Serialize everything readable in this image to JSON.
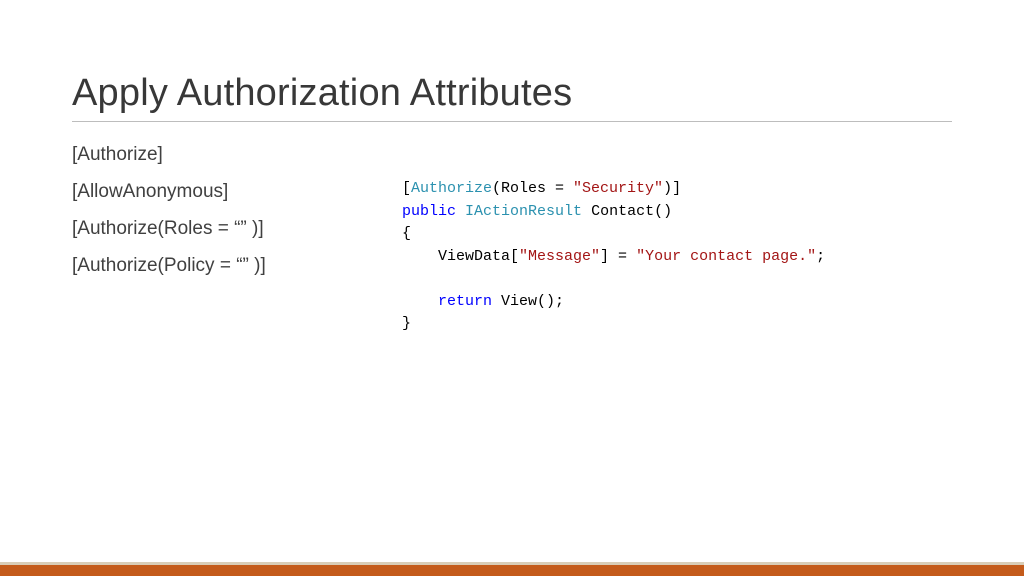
{
  "title": "Apply Authorization Attributes",
  "bullets": [
    "[Authorize]",
    "[AllowAnonymous]",
    "[Authorize(Roles = “” )]",
    "[Authorize(Policy = “” )]"
  ],
  "code": {
    "l1": {
      "open": "[",
      "attr": "Authorize",
      "paren_open": "(Roles = ",
      "str": "\"Security\"",
      "paren_close": ")",
      "close": "]"
    },
    "l2": {
      "kw1": "public",
      "sp1": " ",
      "type": "IActionResult",
      "sp2": " ",
      "name": "Contact()"
    },
    "l3": "{",
    "l4": {
      "indent": "    ",
      "view": "ViewData[",
      "key": "\"Message\"",
      "mid": "] = ",
      "val": "\"Your contact page.\"",
      "end": ";"
    },
    "l5": "",
    "l6": {
      "indent": "    ",
      "kw": "return",
      "rest": " View();"
    },
    "l7": "}"
  }
}
